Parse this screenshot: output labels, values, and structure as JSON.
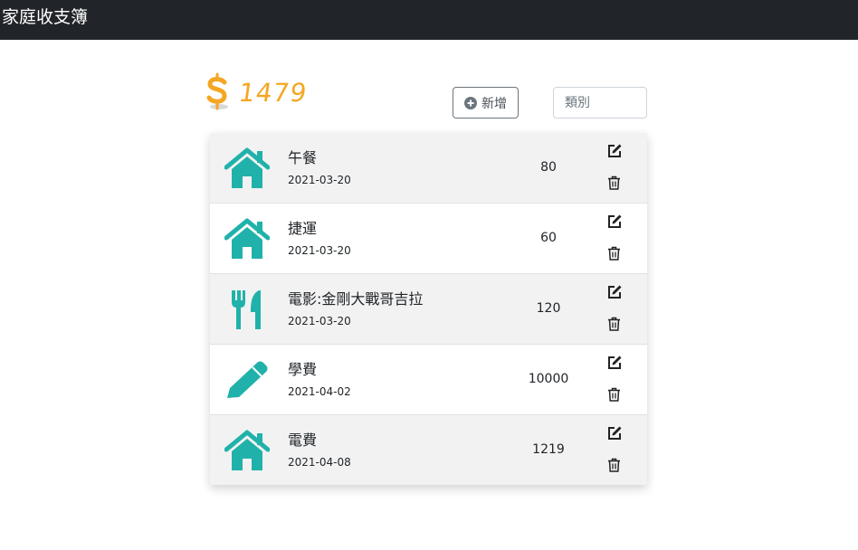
{
  "header": {
    "title": "家庭收支簿"
  },
  "summary": {
    "total": "1479",
    "icon": "dollar-icon"
  },
  "toolbar": {
    "add_label": "新增",
    "add_icon": "plus-circle-icon"
  },
  "filter": {
    "placeholder": "類別",
    "value": ""
  },
  "items": [
    {
      "name": "午餐",
      "date": "2021-03-20",
      "amount": "80",
      "icon": "home-icon"
    },
    {
      "name": "捷運",
      "date": "2021-03-20",
      "amount": "60",
      "icon": "home-icon"
    },
    {
      "name": "電影:金剛大戰哥吉拉",
      "date": "2021-03-20",
      "amount": "120",
      "icon": "utensils-icon"
    },
    {
      "name": "學費",
      "date": "2021-04-02",
      "amount": "10000",
      "icon": "pencil-icon"
    },
    {
      "name": "電費",
      "date": "2021-04-08",
      "amount": "1219",
      "icon": "home-icon"
    }
  ],
  "colors": {
    "accent": "#f5a623",
    "icon_teal": "#20b2aa",
    "navbar": "#212529"
  }
}
